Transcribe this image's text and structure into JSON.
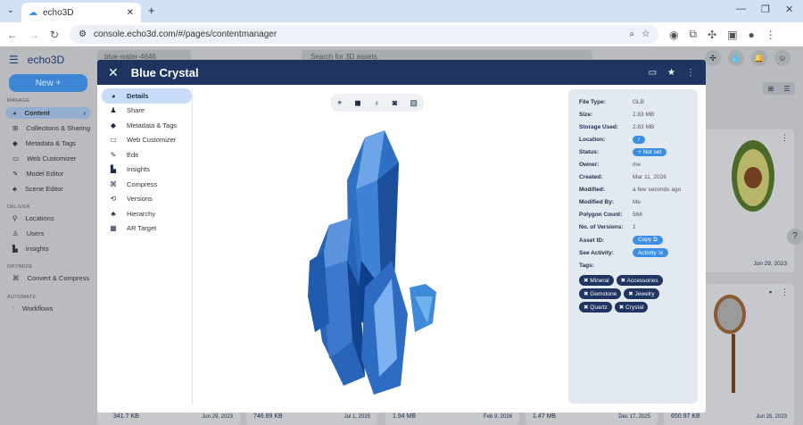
{
  "browser": {
    "tab_title": "echo3D",
    "url": "console.echo3d.com/#/pages/contentmanager"
  },
  "app": {
    "logo": "echo3D",
    "new_button": "New +",
    "project": "blue-water-4646",
    "search_placeholder": "Search for 3D assets",
    "sections": [
      {
        "label": "MANAGE",
        "items": [
          "Content",
          "Collections & Sharing",
          "Metadata & Tags",
          "Web Customizer",
          "Model Editor",
          "Scene Editor"
        ]
      },
      {
        "label": "DELIVER",
        "items": [
          "Locations",
          "Users",
          "Insights"
        ]
      },
      {
        "label": "OPTIMIZE",
        "items": [
          "Convert & Compress"
        ]
      },
      {
        "label": "AUTOMATE",
        "items": [
          "Workflows"
        ]
      }
    ],
    "cards": [
      {
        "size": "341.7 KB",
        "date": "Jun 29, 2023"
      },
      {
        "size": "746.89 KB",
        "date": "Jul 1, 2025"
      },
      {
        "size": "1.94 MB",
        "date": "Feb 9, 2026"
      },
      {
        "size": "1.47 MB",
        "date": "Dec 17, 2025"
      },
      {
        "size": "650.97 KB",
        "date": "Jun 26, 2023"
      }
    ],
    "avocado_date": "Jun 29, 2023"
  },
  "modal": {
    "title": "Blue Crystal",
    "nav": [
      {
        "label": "Details",
        "icon": "palette-icon",
        "active": true
      },
      {
        "label": "Share",
        "icon": "user-plus-icon"
      },
      {
        "label": "Metadata & Tags",
        "icon": "tag-icon"
      },
      {
        "label": "Web Customizer",
        "icon": "vr-icon"
      },
      {
        "label": "Edit",
        "icon": "pencil-icon"
      },
      {
        "label": "Insights",
        "icon": "chart-icon"
      },
      {
        "label": "Compress",
        "icon": "compress-icon"
      },
      {
        "label": "Versions",
        "icon": "versions-icon"
      },
      {
        "label": "Hierarchy",
        "icon": "hierarchy-icon"
      },
      {
        "label": "AR Target",
        "icon": "qr-icon"
      }
    ],
    "details": [
      {
        "key": "File Type:",
        "value": "GLB"
      },
      {
        "key": "Size:",
        "value": "2.83 MB"
      },
      {
        "key": "Storage Used:",
        "value": "2.83 MB"
      },
      {
        "key": "Location:",
        "value": "/",
        "pill": true
      },
      {
        "key": "Status:",
        "value": "+ Not set",
        "pill": true
      },
      {
        "key": "Owner:",
        "value": "me"
      },
      {
        "key": "Created:",
        "value": "Mar 11, 2026"
      },
      {
        "key": "Modified:",
        "value": "a few seconds ago"
      },
      {
        "key": "Modified By:",
        "value": "Me"
      },
      {
        "key": "Polygon Count:",
        "value": "568"
      },
      {
        "key": "No. of Versions:",
        "value": "1"
      },
      {
        "key": "Asset ID:",
        "value": "Copy ⧉",
        "pill": true
      },
      {
        "key": "See Activity:",
        "value": "Activity ⇲",
        "pill": true
      }
    ],
    "tags_label": "Tags:",
    "tags": [
      "Mineral",
      "Accessories",
      "Gemstone",
      "Jewelry",
      "Quartz",
      "Crystal"
    ]
  },
  "colors": {
    "navy": "#1f3460",
    "accent": "#3a8ee6"
  }
}
